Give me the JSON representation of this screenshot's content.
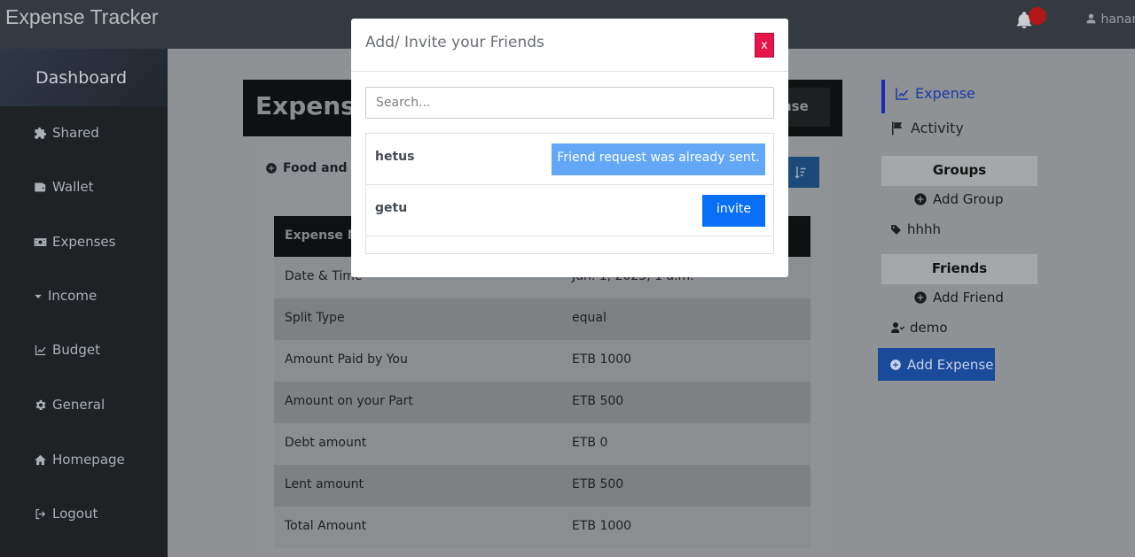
{
  "app": {
    "title": "Expense Tracker",
    "user": "hanan"
  },
  "sidebar": {
    "title": "Dashboard",
    "items": [
      {
        "label": "Shared",
        "icon": "puzzle-icon"
      },
      {
        "label": "Wallet",
        "icon": "wallet-icon"
      },
      {
        "label": "Expenses",
        "icon": "money-icon"
      },
      {
        "label": "Income",
        "icon": "caret-down-icon"
      },
      {
        "label": "Budget",
        "icon": "chart-line-icon"
      },
      {
        "label": "General",
        "icon": "gear-icon"
      },
      {
        "label": "Homepage",
        "icon": "home-icon"
      },
      {
        "label": "Logout",
        "icon": "sign-out-icon"
      }
    ]
  },
  "page": {
    "header_title": "Expense",
    "header_button": "nse",
    "filter_label": "Food and D",
    "table_header": "Expense N",
    "rows": [
      {
        "key": "Date & Time",
        "value": "Jun. 1, 2025, 1 a.m."
      },
      {
        "key": "Split Type",
        "value": "equal"
      },
      {
        "key": "Amount Paid by You",
        "value": "ETB 1000"
      },
      {
        "key": "Amount on your Part",
        "value": "ETB 500"
      },
      {
        "key": "Debt amount",
        "value": "ETB 0"
      },
      {
        "key": "Lent amount",
        "value": "ETB 500"
      },
      {
        "key": "Total Amount",
        "value": "ETB 1000"
      }
    ]
  },
  "rightnav": {
    "expense": "Expense",
    "activity": "Activity",
    "groups_title": "Groups",
    "add_group": "Add Group",
    "group_item": "hhhh",
    "friends_title": "Friends",
    "add_friend": "Add Friend",
    "friend_item": "demo",
    "add_expense": "Add Expense"
  },
  "modal": {
    "title": "Add/ Invite your Friends",
    "close_label": "x",
    "search_placeholder": "Search...",
    "friends": [
      {
        "name": "hetus",
        "status": "Friend request was already sent."
      },
      {
        "name": "getu",
        "action": "invite"
      }
    ]
  },
  "colors": {
    "primary": "#0a6ff7",
    "danger": "#e6154a",
    "info_light": "#63a8f7",
    "dark": "#343a40"
  }
}
